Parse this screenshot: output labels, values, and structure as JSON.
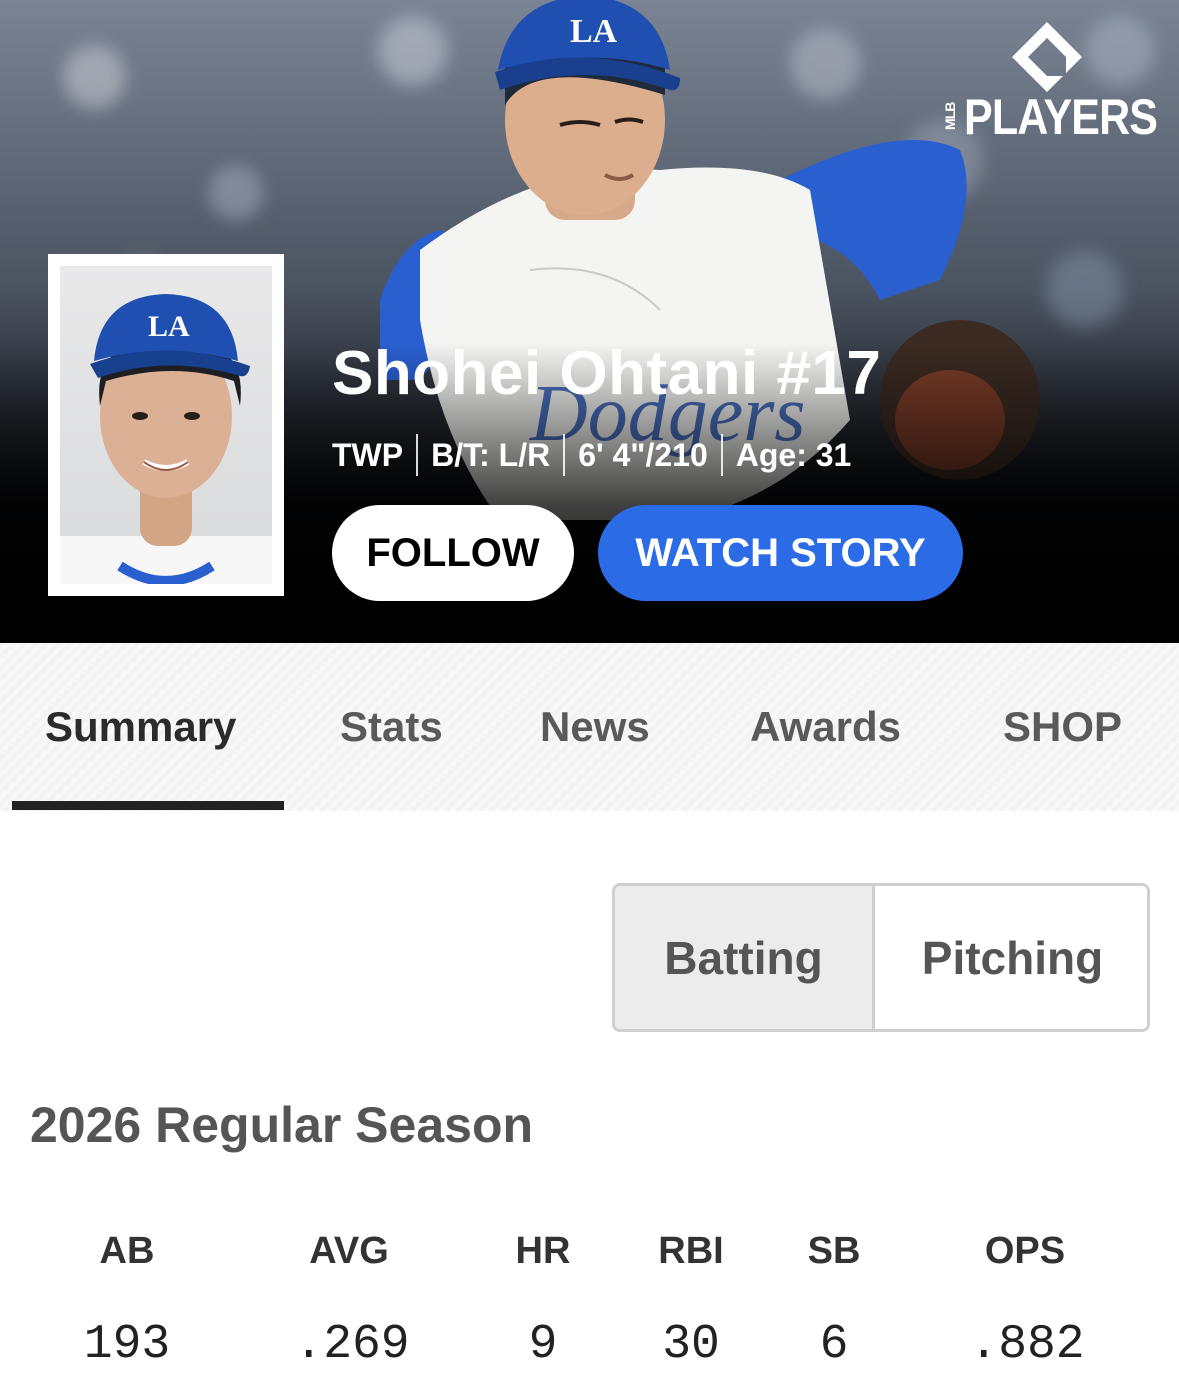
{
  "brand": {
    "mark": "MLB",
    "name": "PLAYERS"
  },
  "player": {
    "name": "Shohei Ohtani #17",
    "bio": [
      "TWP",
      "B/T: L/R",
      "6' 4\"/210",
      "Age: 31"
    ],
    "cap_logo": "LA"
  },
  "actions": {
    "follow": "FOLLOW",
    "watch_story": "WATCH STORY"
  },
  "tabs": [
    {
      "label": "Summary",
      "active": true
    },
    {
      "label": "Stats"
    },
    {
      "label": "News"
    },
    {
      "label": "Awards"
    },
    {
      "label": "SHOP"
    }
  ],
  "stat_toggle": {
    "options": [
      "Batting",
      "Pitching"
    ],
    "selected": "Batting"
  },
  "season_title": "2026 Regular Season",
  "stats": {
    "headers": [
      "AB",
      "AVG",
      "HR",
      "RBI",
      "SB",
      "OPS"
    ],
    "values": [
      "193",
      ".269",
      "9",
      "30",
      "6",
      ".882"
    ]
  },
  "colors": {
    "accent_blue": "#2c6be6",
    "dodger_blue": "#1f4fb0",
    "tab_indicator": "#222222"
  },
  "icons": {
    "logo": "players-diamond-icon"
  }
}
